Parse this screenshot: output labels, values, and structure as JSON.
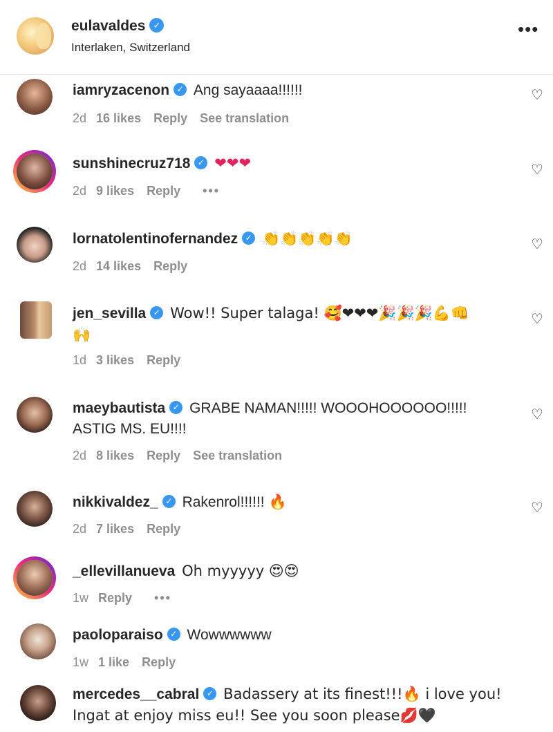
{
  "header": {
    "username": "eulavaldes",
    "location": "Interlaken, Switzerland",
    "more_label": "•••",
    "verified_mark": "✓"
  },
  "labels": {
    "reply": "Reply",
    "see_translation": "See translation",
    "dots": "•••",
    "heart": "♡",
    "verified": "✓"
  },
  "comments": [
    {
      "username": "iamryzacenon",
      "text": "Ang sayaaaa!!!!!!",
      "time": "2d",
      "likes": "16 likes"
    },
    {
      "username": "sunshinecruz718",
      "text": "❤❤❤",
      "time": "2d",
      "likes": "9 likes"
    },
    {
      "username": "lornatolentinofernandez",
      "text": "👏👏👏👏👏",
      "time": "2d",
      "likes": "14 likes"
    },
    {
      "username": "jen_sevilla",
      "text": "Wow!! Super talaga! 🥰❤❤❤🎉🎉🎉💪👊",
      "text2": "🙌",
      "time": "1d",
      "likes": "3 likes"
    },
    {
      "username": "maeybautista",
      "text": "GRABE NAMAN!!!!! WOOOHOOOOOO!!!!!",
      "text2": "ASTIG MS. EU!!!!",
      "time": "2d",
      "likes": "8 likes"
    },
    {
      "username": "nikkivaldez_",
      "text": "Rakenrol!!!!!! 🔥",
      "time": "2d",
      "likes": "7 likes"
    },
    {
      "username": "_ellevillanueva",
      "text": "Oh myyyyy 😍😍",
      "time": "1w"
    },
    {
      "username": "paoloparaiso",
      "text": "Wowwwwww",
      "time": "1w",
      "likes": "1 like"
    },
    {
      "username": "mercedes__cabral",
      "text": "Badassery at its finest!!!🔥 i love you!",
      "text2": "Ingat at enjoy miss eu!! See you soon please💋🖤"
    }
  ],
  "colors": {
    "verified": "#3897f0",
    "meta": "#8e8e8e",
    "text": "#262626",
    "divider": "#e3e3e3"
  }
}
